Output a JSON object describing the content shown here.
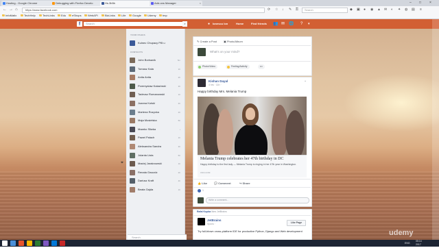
{
  "browser": {
    "tabs": [
      {
        "label": "Hosting - Google Chrome",
        "color": "#4285f4"
      },
      {
        "label": "Debugging with Firefox Develo",
        "color": "#ff9400"
      },
      {
        "label": "Hs.3b5b",
        "color": "#3b5998"
      },
      {
        "label": "Add-ons Manager",
        "color": "#5c5cf2"
      }
    ],
    "url": "https://www.facebook.com",
    "search_placeholder": "Search",
    "bookmarks": [
      "InfoMatix",
      "TechHelp",
      "TechLinks",
      "Edu",
      "eShops",
      "WebAPI",
      "BizLinks",
      "Life",
      "Google",
      "Udemy",
      "tmp"
    ]
  },
  "facebook": {
    "logo": "f",
    "search_placeholder": "Search",
    "profile_name": "Ionescu Ion",
    "home_label": "Home",
    "find_friends_label": "Find friends",
    "your_pages_header": "YOUR PAGES",
    "page_item": "Kulnec Chupacy Pt5 u",
    "contacts_header": "CONTACTS",
    "contacts": [
      {
        "name": "John Borisavik",
        "time": "5m",
        "color": "#7b6a5a"
      },
      {
        "name": "Tomasz Kala",
        "time": "1h",
        "color": "#5d6a78"
      },
      {
        "name": "Anita Anita",
        "time": "2h",
        "color": "#a67b64"
      },
      {
        "name": "Przemyslaw Kalazinski",
        "time": "3h",
        "color": "#4d5a4a"
      },
      {
        "name": "Tadeusz Romanowski",
        "time": "1h",
        "color": "#6f5e52"
      },
      {
        "name": "Joanna Kolski",
        "time": "4h",
        "color": "#8c7063"
      },
      {
        "name": "Marlena Rozycka",
        "time": "2h",
        "color": "#6b7d8c"
      },
      {
        "name": "Maja Musielska",
        "time": "5h",
        "color": "#9a7a66"
      },
      {
        "name": "Maarko Sliwka",
        "time": "•",
        "color": "#4a4a55"
      },
      {
        "name": "Pawel Palach",
        "time": "1h",
        "color": "#725f4f"
      },
      {
        "name": "Aleksandra Sandra",
        "time": "3h",
        "color": "#b08974"
      },
      {
        "name": "Jolanta Lista",
        "time": "6h",
        "color": "#5f6e63"
      },
      {
        "name": "Maciej Jaraknowski",
        "time": "1h",
        "color": "#6c5a4e"
      },
      {
        "name": "Renata Gwozdz",
        "time": "2h",
        "color": "#8a6f66"
      },
      {
        "name": "Dariusz Kraft",
        "time": "4h",
        "color": "#55606a"
      },
      {
        "name": "Beata Gajda",
        "time": "1h",
        "color": "#a17d6a"
      }
    ],
    "chat_search_placeholder": "Search"
  },
  "composer": {
    "tab_post": "Create a Post",
    "tab_album": "Photo/Album",
    "placeholder": "What's on your mind?",
    "btn_photo": "Photo/Video",
    "btn_feeling": "Feeling/Activity",
    "btn_more": "•••"
  },
  "post": {
    "author": "Kishan Dayal",
    "time": "4 hrs · 11h · ",
    "text": "Happy birthday Mrs. Melania Trump",
    "link_title": "Melania Trump celebrates her 47th birthday in DC",
    "link_desc": "Happy birthday to the first lady — Melania Trump is ringing in her 47th year in Washington.",
    "link_domain": "CNN.COM",
    "like": "Like",
    "comment": "Comment",
    "share": "Share",
    "reactions": "1",
    "comment_placeholder": "Write a comment..."
  },
  "sponsored": {
    "header_user": "Rafal Kupka",
    "header_text": "likes JetBrains",
    "page": "JetBrains",
    "sub": "Spons · ",
    "like_page": "Like Page",
    "text": "Try full-blown cross-platform IDE for productive Python, Django and Web development"
  },
  "taskbar": {
    "lang": "ENG",
    "time": "05:14",
    "date": "2017"
  },
  "watermark": "udemy"
}
